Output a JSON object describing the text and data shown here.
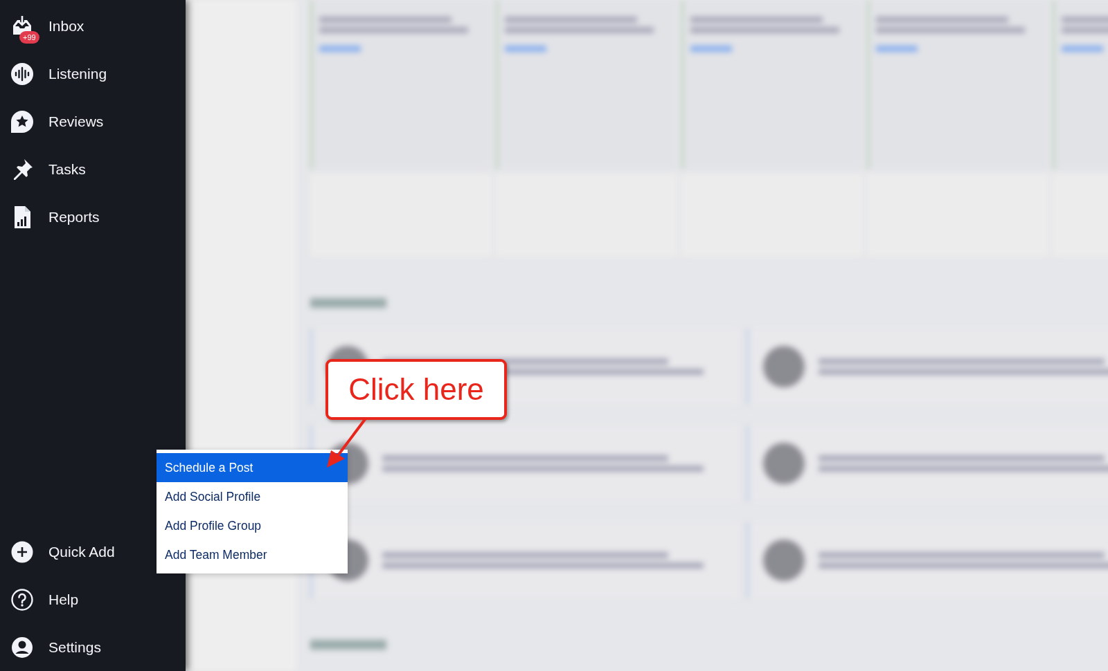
{
  "sidebar": {
    "top_items": [
      {
        "kind": "inbox",
        "label": "Inbox",
        "badge": "+99"
      },
      {
        "kind": "listening",
        "label": "Listening"
      },
      {
        "kind": "reviews",
        "label": "Reviews"
      },
      {
        "kind": "tasks",
        "label": "Tasks"
      },
      {
        "kind": "reports",
        "label": "Reports"
      }
    ],
    "bottom_items": [
      {
        "kind": "quick_add",
        "label": "Quick Add"
      },
      {
        "kind": "help",
        "label": "Help"
      },
      {
        "kind": "settings",
        "label": "Settings"
      }
    ]
  },
  "quick_add_menu": {
    "items": [
      {
        "label": "Schedule a Post",
        "selected": true
      },
      {
        "label": "Add Social Profile",
        "selected": false
      },
      {
        "label": "Add Profile Group",
        "selected": false
      },
      {
        "label": "Add Team Member",
        "selected": false
      }
    ]
  },
  "annotation": {
    "text": "Click here"
  }
}
